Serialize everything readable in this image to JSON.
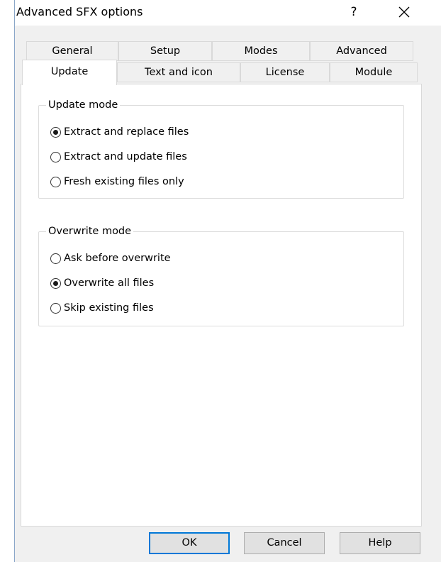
{
  "window": {
    "title": "Advanced SFX options",
    "help_glyph": "?",
    "close_icon": "close-icon"
  },
  "tabs": {
    "row_back": [
      {
        "label": "General"
      },
      {
        "label": "Setup"
      },
      {
        "label": "Modes"
      },
      {
        "label": "Advanced"
      }
    ],
    "row_front": [
      {
        "label": "Update",
        "selected": true
      },
      {
        "label": "Text and icon"
      },
      {
        "label": "License"
      },
      {
        "label": "Module"
      }
    ]
  },
  "update_mode": {
    "label": "Update mode",
    "options": [
      {
        "label": "Extract and replace files",
        "checked": true
      },
      {
        "label": "Extract and update files",
        "checked": false
      },
      {
        "label": "Fresh existing files only",
        "checked": false
      }
    ]
  },
  "overwrite_mode": {
    "label": "Overwrite mode",
    "options": [
      {
        "label": "Ask before overwrite",
        "checked": false
      },
      {
        "label": "Overwrite all files",
        "checked": true
      },
      {
        "label": "Skip existing files",
        "checked": false
      }
    ]
  },
  "buttons": {
    "ok": "OK",
    "cancel": "Cancel",
    "help": "Help"
  },
  "colors": {
    "accent": "#0078d7",
    "window_bg": "#f0f0f0",
    "panel_bg": "#ffffff"
  }
}
